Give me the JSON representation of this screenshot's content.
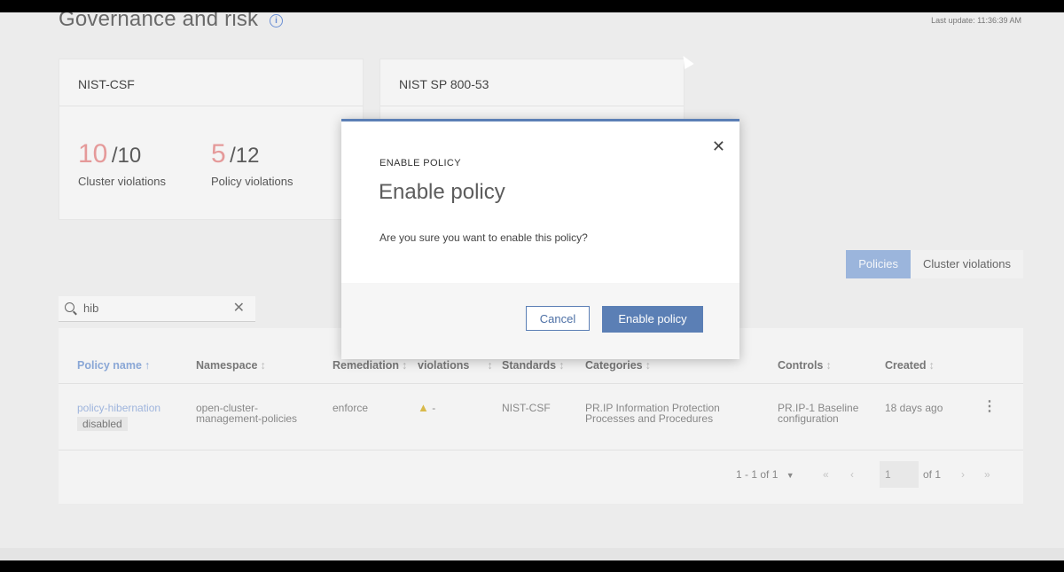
{
  "page": {
    "title": "Governance and risk",
    "last_update": "Last update: 11:36:39 AM"
  },
  "cards": [
    {
      "title": "NIST-CSF",
      "stats": [
        {
          "num": "10",
          "den": "/10",
          "label": "Cluster violations"
        },
        {
          "num": "5",
          "den": "/12",
          "label": "Policy violations"
        }
      ]
    },
    {
      "title": "NIST SP 800-53"
    }
  ],
  "tabs": {
    "policies": "Policies",
    "cluster_violations": "Cluster violations"
  },
  "search": {
    "value": "hib"
  },
  "table": {
    "headers": [
      "Policy name",
      "Namespace",
      "Remediation",
      "violations",
      "Standards",
      "Categories",
      "Controls",
      "Created"
    ],
    "row": {
      "policy_name": "policy-hibernation",
      "status": "disabled",
      "namespace": "open-cluster-management-policies",
      "remediation": "enforce",
      "violations": "-",
      "standards": "NIST-CSF",
      "categories": "PR.IP Information Protection Processes and Procedures",
      "controls": "PR.IP-1 Baseline configuration",
      "created": "18 days ago"
    },
    "pagination": {
      "range": "1 - 1 of 1",
      "page": "1",
      "of": "of 1"
    }
  },
  "modal": {
    "eyebrow": "ENABLE POLICY",
    "title": "Enable policy",
    "body": "Are you sure you want to enable this policy?",
    "cancel": "Cancel",
    "confirm": "Enable policy"
  }
}
